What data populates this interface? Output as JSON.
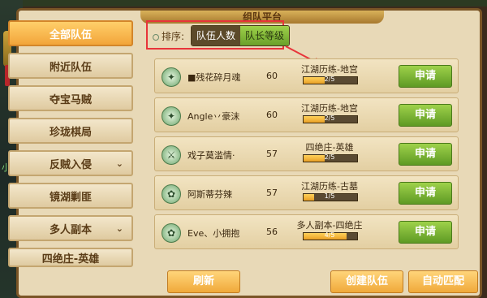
{
  "window": {
    "title": "组队平台"
  },
  "top_strip_text": "…",
  "side_char": "小伢",
  "nav": [
    {
      "label": "全部队伍",
      "active": true
    },
    {
      "label": "附近队伍"
    },
    {
      "label": "夺宝马贼"
    },
    {
      "label": "珍珑棋局"
    },
    {
      "label": "反贼入侵",
      "chevron": true
    },
    {
      "label": "镜湖剿匪"
    },
    {
      "label": "多人副本",
      "chevron": true
    },
    {
      "label": "四绝庄-英雄"
    }
  ],
  "sort": {
    "label": "排序:",
    "options": [
      "队伍人数",
      "队长等级"
    ],
    "selected": "队长等级"
  },
  "rows": [
    {
      "icon": "✦",
      "leader": "■残花碎月魂",
      "level": "60",
      "activity": "江湖历练-地宫",
      "count": "2/5",
      "fill": 0.4,
      "apply": "申请"
    },
    {
      "icon": "✦",
      "leader": "Angle丷豪沫",
      "level": "60",
      "activity": "江湖历练-地宫",
      "count": "2/5",
      "fill": 0.4,
      "apply": "申请"
    },
    {
      "icon": "⚔",
      "leader": "戏子莫滥情·",
      "level": "57",
      "activity": "四绝庄-英雄",
      "count": "2/5",
      "fill": 0.4,
      "apply": "申请"
    },
    {
      "icon": "✿",
      "leader": "阿斯蒂芬辣",
      "level": "57",
      "activity": "江湖历练-古墓",
      "count": "1/5",
      "fill": 0.2,
      "apply": "申请"
    },
    {
      "icon": "✿",
      "leader": "Eve、小拥抱",
      "level": "56",
      "activity": "多人副本-四绝庄",
      "count": "4/5",
      "fill": 0.8,
      "apply": "申请"
    }
  ],
  "buttons": {
    "refresh": "刷新",
    "create": "创建队伍",
    "auto_match": "自动匹配"
  }
}
